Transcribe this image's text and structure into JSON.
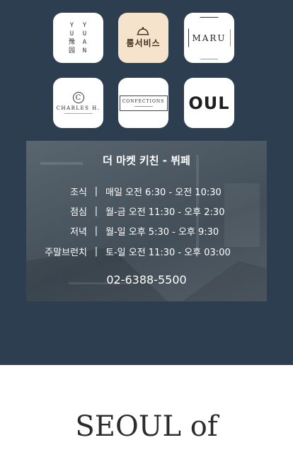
{
  "tiles": {
    "yuyuan": {
      "col1": [
        "Y",
        "U",
        "豫",
        "园"
      ],
      "col2": [
        "Y",
        "U",
        "A",
        "N"
      ]
    },
    "room_service": {
      "label": "룸서비스"
    },
    "maru": {
      "label": "MARU"
    },
    "charles_h": {
      "label": "CHARLES H."
    },
    "confections": {
      "label": "CONFECTIONS"
    },
    "oul": {
      "label": "OUL"
    }
  },
  "restaurant": {
    "title": "더 마켓 키친 - 뷔페",
    "hours": [
      {
        "meal": "조식",
        "separator": "|",
        "time": "매일 오전 6:30 - 오전 10:30"
      },
      {
        "meal": "점심",
        "separator": "|",
        "time": "월-금 오전 11:30 - 오후 2:30"
      },
      {
        "meal": "저녁",
        "separator": "|",
        "time": "월-일 오후 5:30 - 오후 9:30"
      },
      {
        "meal": "주말브런치",
        "separator": "|",
        "time": "토-일 오전 11:30 - 오후 03:00"
      }
    ],
    "phone": "02-6388-5500"
  },
  "footer": {
    "heading": "SEOUL of"
  },
  "colors": {
    "background_dark": "#2d3e51",
    "room_service_tile": "#f6e3cc",
    "text_light": "#ffffff"
  }
}
